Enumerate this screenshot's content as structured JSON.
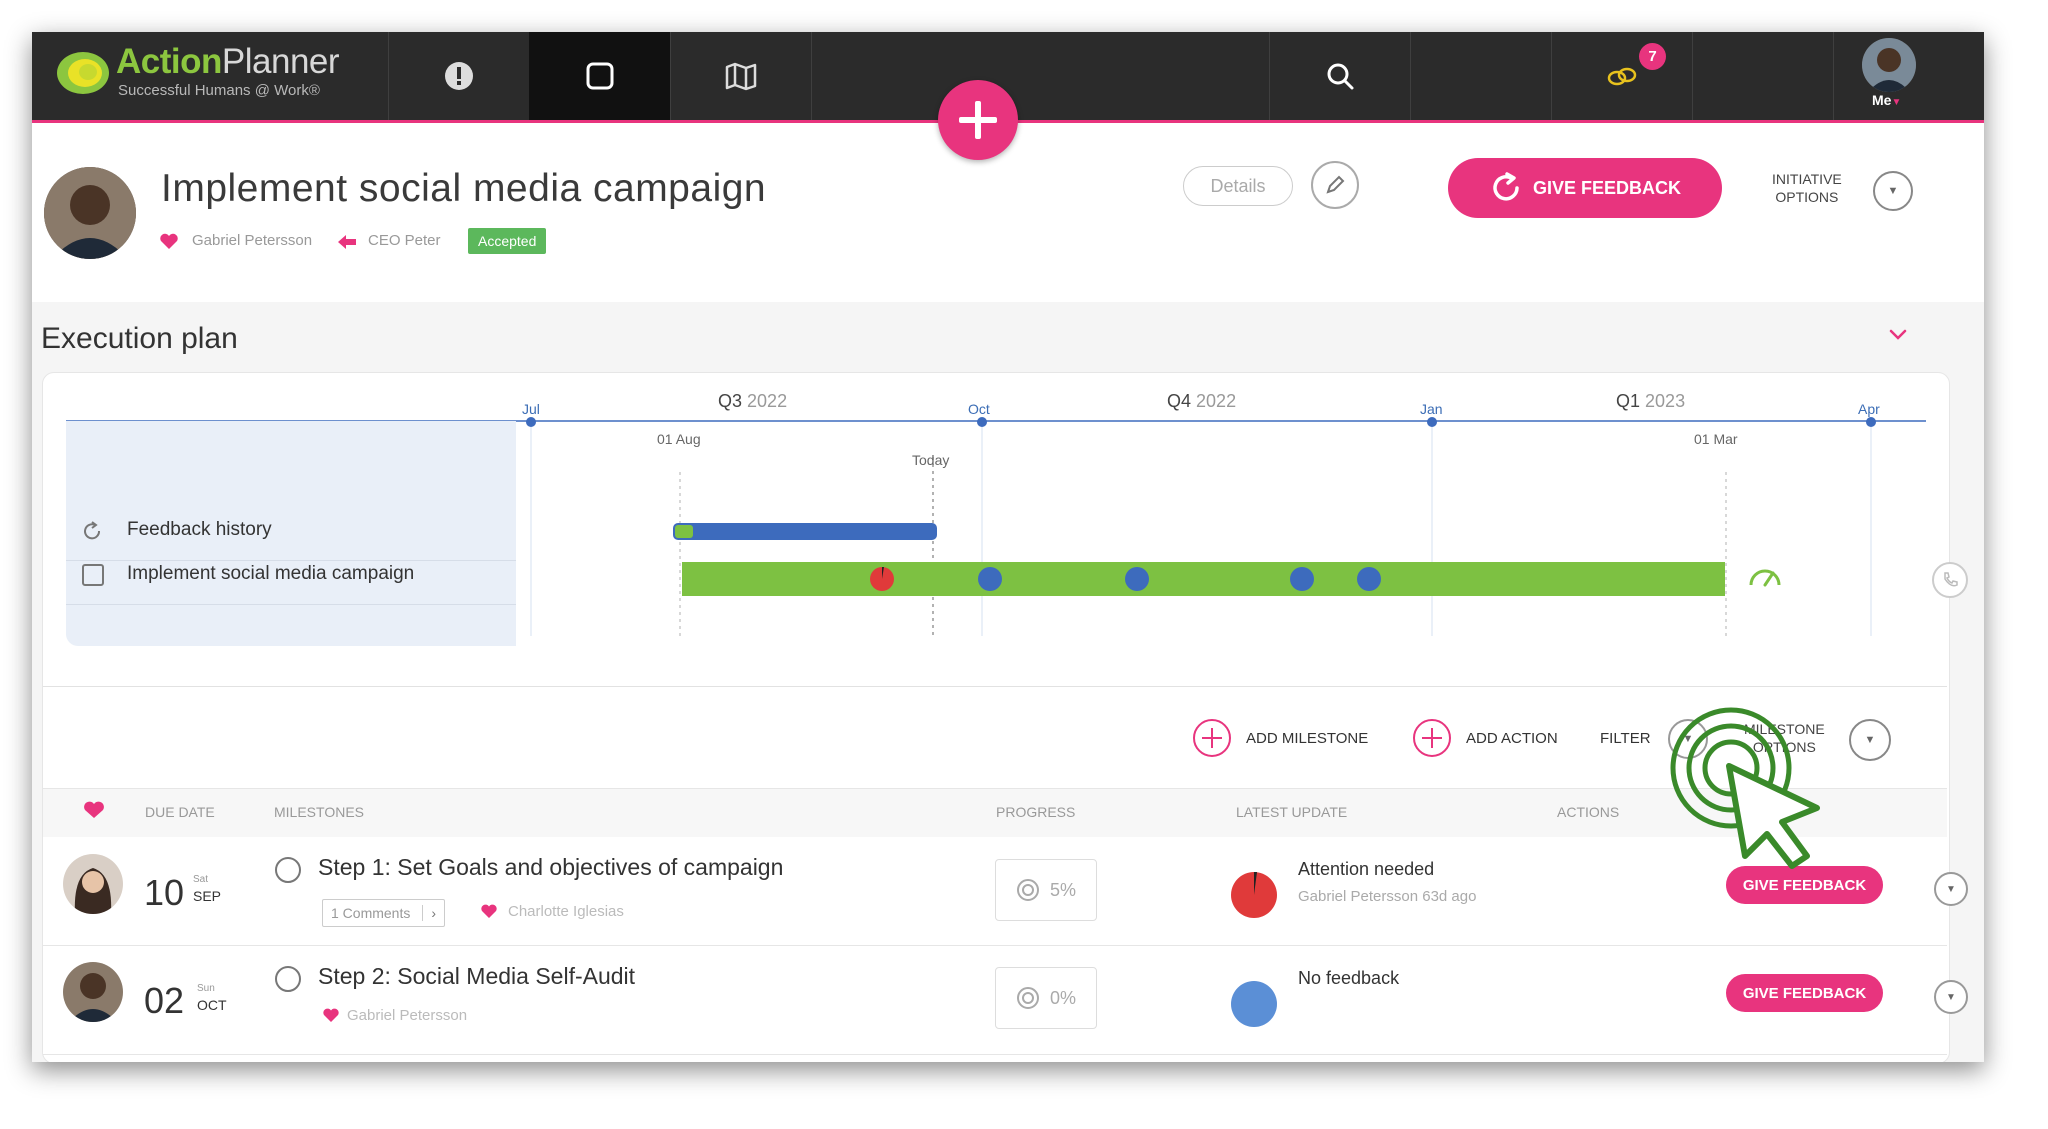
{
  "nav": {
    "logo_brand_a": "Action",
    "logo_brand_b": "Planner",
    "logo_tagline": "Successful Humans @ Work®",
    "icons": [
      "alert-icon",
      "square-icon",
      "map-icon",
      "search-icon",
      "bonus-icon",
      "avatar"
    ],
    "notification_count": "7",
    "me_label": "Me"
  },
  "header": {
    "title": "Implement social media campaign",
    "owner": "Gabriel Petersson",
    "assigned_by": "CEO Peter",
    "status": "Accepted",
    "details_label": "Details",
    "give_feedback_label": "GIVE FEEDBACK",
    "initiative_options_line1": "INITIATIVE",
    "initiative_options_line2": "OPTIONS"
  },
  "execution_plan": {
    "title": "Execution plan",
    "timeline": {
      "quarters": [
        {
          "q": "Q3",
          "year": "2022"
        },
        {
          "q": "Q4",
          "year": "2022"
        },
        {
          "q": "Q1",
          "year": "2023"
        }
      ],
      "months": [
        "Jul",
        "Oct",
        "Jan",
        "Apr"
      ],
      "markers": [
        "01 Aug",
        "Today",
        "01 Mar"
      ]
    },
    "rows": [
      {
        "label": "Feedback history"
      },
      {
        "label": "Implement social media campaign"
      }
    ]
  },
  "milestone_toolbar": {
    "add_milestone": "ADD MILESTONE",
    "add_action": "ADD ACTION",
    "filter": "FILTER",
    "milestone_options_line1": "MILESTONE",
    "milestone_options_line2": "OPTIONS"
  },
  "table": {
    "headers": [
      "DUE DATE",
      "MILESTONES",
      "PROGRESS",
      "LATEST UPDATE",
      "ACTIONS"
    ],
    "rows": [
      {
        "day": "10",
        "dow": "Sat",
        "month": "SEP",
        "title": "Step 1: Set Goals and objectives of campaign",
        "comments": "1 Comments",
        "person": "Charlotte Iglesias",
        "progress": "5%",
        "update_title": "Attention needed",
        "update_sub": "Gabriel Petersson 63d ago",
        "action": "GIVE FEEDBACK"
      },
      {
        "day": "02",
        "dow": "Sun",
        "month": "OCT",
        "title": "Step 2: Social Media Self-Audit",
        "person": "Gabriel Petersson",
        "progress": "0%",
        "update_title": "No feedback",
        "action": "GIVE FEEDBACK"
      }
    ]
  },
  "colors": {
    "accent": "#e8347e",
    "green": "#7dc142",
    "blue": "#3d6bbd",
    "red": "#e03a3a"
  }
}
